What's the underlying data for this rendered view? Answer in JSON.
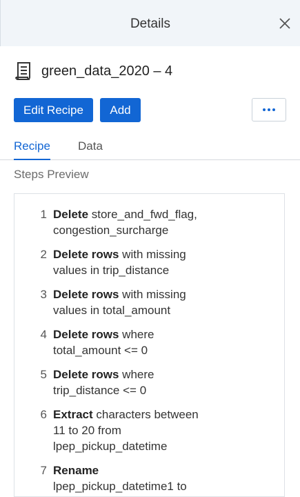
{
  "header": {
    "title": "Details"
  },
  "dataset": {
    "name": "green_data_2020 – 4"
  },
  "buttons": {
    "edit": "Edit Recipe",
    "add": "Add"
  },
  "tabs": [
    {
      "label": "Recipe"
    },
    {
      "label": "Data"
    }
  ],
  "steps_heading": "Steps Preview",
  "steps": [
    {
      "num": "1",
      "action": "Delete",
      "detail": " store_and_fwd_flag, congestion_surcharge"
    },
    {
      "num": "2",
      "action": "Delete rows",
      "detail": " with missing values in trip_distance"
    },
    {
      "num": "3",
      "action": "Delete rows",
      "detail": " with missing values in total_amount"
    },
    {
      "num": "4",
      "action": "Delete rows",
      "detail": " where total_amount <= 0"
    },
    {
      "num": "5",
      "action": "Delete rows",
      "detail": " where trip_distance <= 0"
    },
    {
      "num": "6",
      "action": "Extract",
      "detail": " characters between 11 to 20 from lpep_pickup_datetime"
    },
    {
      "num": "7",
      "action": "Rename",
      "detail": " lpep_pickup_datetime1 to"
    }
  ],
  "colors": {
    "accent": "#1266d4",
    "header_bg": "#f1f5f9"
  }
}
